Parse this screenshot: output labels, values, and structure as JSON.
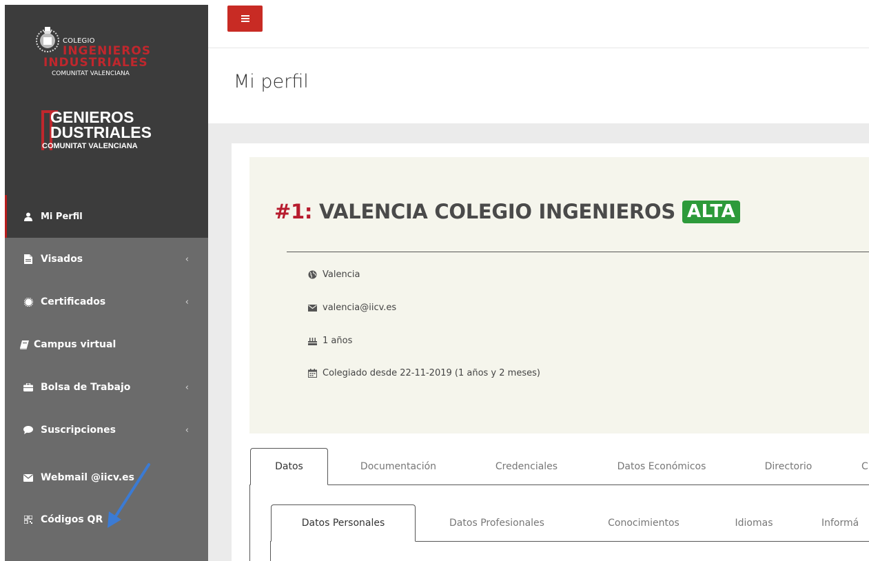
{
  "brand": {
    "logo1_small": "COLEGIO",
    "logo1_red1": "INGENIEROS",
    "logo1_red2": "INDUSTRIALES",
    "logo1_sub": "COMUNITAT VALENCIANA",
    "logo2_line1": "GENIEROS",
    "logo2_line2": "DUSTRIALES",
    "logo2_sub": "COMUNITAT VALENCIANA",
    "accent_color": "#c0272d"
  },
  "sidebar": {
    "items": [
      {
        "label": "Mi Perfil",
        "icon": "user-icon"
      },
      {
        "label": "Visados",
        "icon": "file-icon",
        "chevron": "‹"
      },
      {
        "label": "Certificados",
        "icon": "certificate-icon",
        "chevron": "‹"
      },
      {
        "label": "Campus virtual",
        "icon": "book-icon"
      },
      {
        "label": "Bolsa de Trabajo",
        "icon": "briefcase-icon",
        "chevron": "‹"
      },
      {
        "label": "Suscripciones",
        "icon": "comment-icon",
        "chevron": "‹"
      },
      {
        "label": "Webmail @iicv.es",
        "icon": "envelope-icon"
      },
      {
        "label": "Códigos QR",
        "icon": "qrcode-icon"
      }
    ]
  },
  "header": {
    "title": "Mi perfil"
  },
  "profile": {
    "number": "#1:",
    "name": "VALENCIA COLEGIO INGENIEROS",
    "status": "ALTA",
    "status_color": "#2d9a3a",
    "city": "Valencia",
    "email": "valencia@iicv.es",
    "age": "1 años",
    "member_since": "Colegiado desde 22-11-2019 (1 años y 2 meses)"
  },
  "tabs": [
    {
      "label": "Datos"
    },
    {
      "label": "Documentación"
    },
    {
      "label": "Credenciales"
    },
    {
      "label": "Datos Económicos"
    },
    {
      "label": "Directorio"
    },
    {
      "label": "C"
    }
  ],
  "subtabs": [
    {
      "label": "Datos Personales"
    },
    {
      "label": "Datos Profesionales"
    },
    {
      "label": "Conocimientos"
    },
    {
      "label": "Idiomas"
    },
    {
      "label": "Informá"
    }
  ]
}
